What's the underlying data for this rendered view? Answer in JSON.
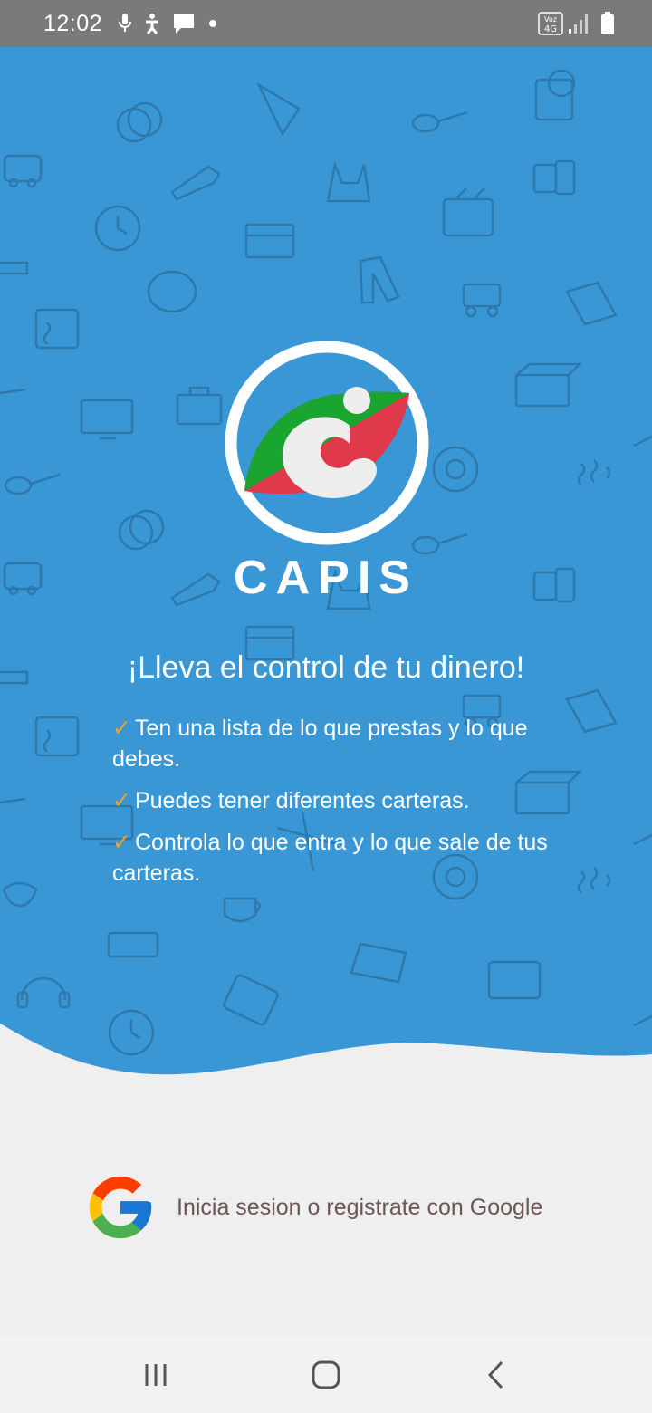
{
  "status_bar": {
    "time": "12:02",
    "left_icons": [
      "mic-icon",
      "accessibility-icon",
      "message-icon",
      "dot-icon"
    ],
    "right_icons": [
      "volte-4g-icon",
      "signal-icon",
      "battery-icon"
    ],
    "network_label": "Voz 4G"
  },
  "hero": {
    "background_color": "#3a97d6",
    "brand": "CAPIS",
    "headline": "¡Lleva el control de tu dinero!",
    "check_mark": "✓",
    "features": [
      "Ten una lista de lo que prestas y lo que debes.",
      "Puedes tener diferentes carteras.",
      "Controla lo que entra y lo que sale de tus carteras."
    ]
  },
  "logo": {
    "colors": {
      "ring": "#ffffff",
      "green": "#1aa531",
      "red": "#e0394c",
      "c_shape": "#eeeeee"
    }
  },
  "google_signin": {
    "label": "Inicia sesion o registrate con Google"
  },
  "nav_bar": {
    "buttons": [
      "recent-apps-icon",
      "home-icon",
      "back-icon"
    ]
  },
  "colors": {
    "accent_check": "#f0a030",
    "bottom_background": "#efefef",
    "status_bar": "#7a7a7a"
  }
}
